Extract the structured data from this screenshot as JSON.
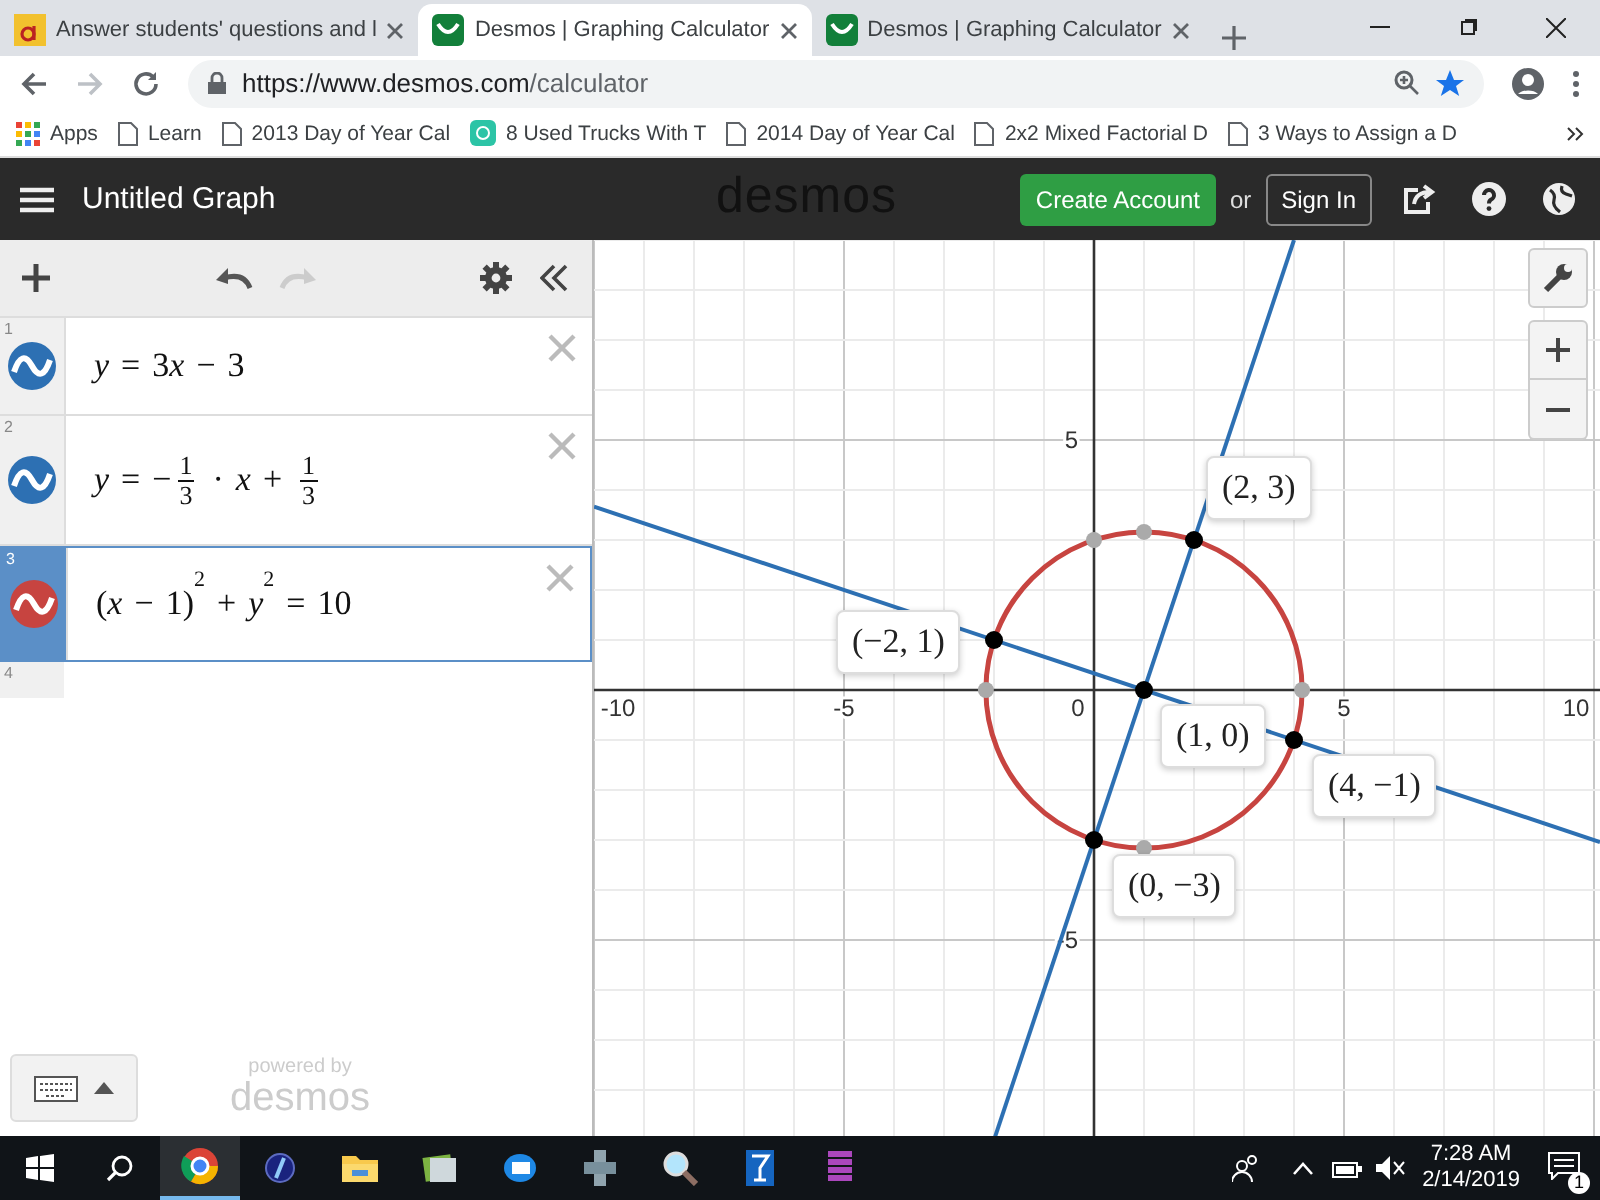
{
  "browser": {
    "tabs": [
      {
        "title": "Answer students' questions and l",
        "selected": false,
        "kind": "quiz"
      },
      {
        "title": "Desmos | Graphing Calculator",
        "selected": true,
        "kind": "desmos"
      },
      {
        "title": "Desmos | Graphing Calculator",
        "selected": false,
        "kind": "desmos"
      }
    ],
    "url": {
      "host": "https://www.desmos.com",
      "path": "/calculator"
    },
    "bookmarks": [
      {
        "label": "Apps",
        "kind": "apps"
      },
      {
        "label": "Learn",
        "kind": "page"
      },
      {
        "label": "2013 Day of Year Cal",
        "kind": "page"
      },
      {
        "label": "8 Used Trucks With T",
        "kind": "site"
      },
      {
        "label": "2014 Day of Year Cal",
        "kind": "page"
      },
      {
        "label": "2x2 Mixed Factorial D",
        "kind": "page"
      },
      {
        "label": "3 Ways to Assign a D",
        "kind": "page"
      }
    ]
  },
  "header": {
    "title": "Untitled Graph",
    "logo": "desmos",
    "create_account": "Create Account",
    "or": "or",
    "sign_in": "Sign In"
  },
  "expressions": [
    {
      "number": "1",
      "color": "#2d70b3",
      "selected": false,
      "tokens": [
        {
          "kind": "var",
          "text": "y"
        },
        {
          "kind": "op",
          "text": "="
        },
        {
          "kind": "num",
          "text": "3"
        },
        {
          "kind": "var",
          "text": "x"
        },
        {
          "kind": "op",
          "text": "−"
        },
        {
          "kind": "num",
          "text": "3"
        }
      ]
    },
    {
      "number": "2",
      "color": "#2d70b3",
      "selected": false,
      "tokens": [
        {
          "kind": "var",
          "text": "y"
        },
        {
          "kind": "op",
          "text": "="
        },
        {
          "kind": "num",
          "text": "−"
        },
        {
          "kind": "frac",
          "num": "1",
          "den": "3"
        },
        {
          "kind": "op",
          "text": "·"
        },
        {
          "kind": "var",
          "text": "x"
        },
        {
          "kind": "op",
          "text": "+"
        },
        {
          "kind": "frac",
          "num": "1",
          "den": "3"
        }
      ]
    },
    {
      "number": "3",
      "color": "#c74440",
      "selected": true,
      "tokens": [
        {
          "kind": "num",
          "text": "("
        },
        {
          "kind": "var",
          "text": "x"
        },
        {
          "kind": "op",
          "text": "−"
        },
        {
          "kind": "num",
          "text": "1"
        },
        {
          "kind": "num",
          "text": ")"
        },
        {
          "kind": "sup",
          "text": "2"
        },
        {
          "kind": "op",
          "text": "+"
        },
        {
          "kind": "var",
          "text": "y"
        },
        {
          "kind": "sup",
          "text": "2"
        },
        {
          "kind": "op",
          "text": "="
        },
        {
          "kind": "num",
          "text": "10"
        }
      ]
    }
  ],
  "empty_row": {
    "number": "4"
  },
  "footer": {
    "powered_by": "powered by",
    "logo": "desmos"
  },
  "graph": {
    "x_ticks": [
      "-10",
      "-5",
      "0",
      "5",
      "10"
    ],
    "y_ticks": [
      "5",
      "-5"
    ],
    "points": [
      "(2, 3)",
      "(−2, 1)",
      "(1, 0)",
      "(4, −1)",
      "(0, −3)"
    ]
  },
  "taskbar": {
    "time": "7:28 AM",
    "date": "2/14/2019",
    "notifications": "1"
  }
}
